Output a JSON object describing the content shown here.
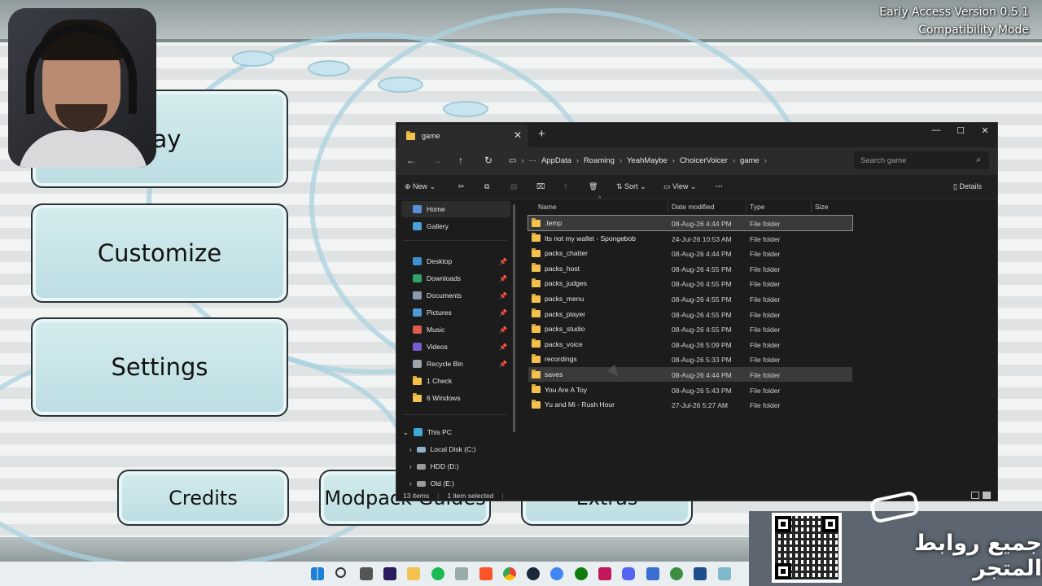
{
  "game": {
    "version_line1": "Early Access Version 0.5.1",
    "version_line2": "Compatibility Mode",
    "buttons": {
      "play_partial": "ay",
      "customize": "Customize",
      "settings": "Settings",
      "credits": "Credits",
      "modpack": "Modpack Guides",
      "extras": "Extras"
    }
  },
  "explorer": {
    "tab_title": "game",
    "breadcrumb": [
      "AppData",
      "Roaming",
      "YeahMaybe",
      "ChoicerVoicer",
      "game"
    ],
    "search_placeholder": "Search game",
    "toolbar": {
      "new_label": "New",
      "sort_label": "Sort",
      "view_label": "View",
      "details_label": "Details"
    },
    "sidebar": {
      "top": [
        {
          "label": "Home",
          "icon": "home-icon"
        },
        {
          "label": "Gallery",
          "icon": "gallery-icon"
        }
      ],
      "pinned": [
        {
          "label": "Desktop",
          "icon": "desktop-icon"
        },
        {
          "label": "Downloads",
          "icon": "downloads-icon"
        },
        {
          "label": "Documents",
          "icon": "documents-icon"
        },
        {
          "label": "Pictures",
          "icon": "pictures-icon"
        },
        {
          "label": "Music",
          "icon": "music-icon"
        },
        {
          "label": "Videos",
          "icon": "videos-icon"
        },
        {
          "label": "Recycle Bin",
          "icon": "recycle-bin-icon"
        },
        {
          "label": "1 Check",
          "icon": "folder-icon"
        },
        {
          "label": "6 Windows",
          "icon": "folder-icon"
        }
      ],
      "this_pc": "This PC",
      "drives": [
        "Local Disk (C:)",
        "HDD (D:)",
        "Old (E:)"
      ]
    },
    "columns": [
      "Name",
      "Date modified",
      "Type",
      "Size"
    ],
    "files": [
      {
        "name": ".temp",
        "date": "08-Aug-26 4:44 PM",
        "type": "File folder"
      },
      {
        "name": "Its not my wallet - Spongebob",
        "date": "24-Jul-26 10:53 AM",
        "type": "File folder"
      },
      {
        "name": "packs_chatter",
        "date": "08-Aug-26 4:44 PM",
        "type": "File folder"
      },
      {
        "name": "packs_host",
        "date": "08-Aug-26 4:55 PM",
        "type": "File folder"
      },
      {
        "name": "packs_judges",
        "date": "08-Aug-26 4:55 PM",
        "type": "File folder"
      },
      {
        "name": "packs_menu",
        "date": "08-Aug-26 4:55 PM",
        "type": "File folder"
      },
      {
        "name": "packs_player",
        "date": "08-Aug-26 4:55 PM",
        "type": "File folder"
      },
      {
        "name": "packs_studio",
        "date": "08-Aug-26 4:55 PM",
        "type": "File folder"
      },
      {
        "name": "packs_voice",
        "date": "08-Aug-26 5:09 PM",
        "type": "File folder"
      },
      {
        "name": "recordings",
        "date": "08-Aug-26 5:33 PM",
        "type": "File folder"
      },
      {
        "name": "saves",
        "date": "08-Aug-26 4:44 PM",
        "type": "File folder"
      },
      {
        "name": "You Are A Toy",
        "date": "08-Aug-26 5:43 PM",
        "type": "File folder"
      },
      {
        "name": "Yu and Mi - Rush Hour",
        "date": "27-Jul-26 5:27 AM",
        "type": "File folder"
      }
    ],
    "status": {
      "count": "13 items",
      "selected": "1 item selected"
    }
  },
  "overlay": {
    "promo_text": "جميع روابط المتجر"
  },
  "colors": {
    "folder": "#f2c14e",
    "explorer_bg": "#1c1c1c",
    "button_face": "#bcdde2"
  }
}
